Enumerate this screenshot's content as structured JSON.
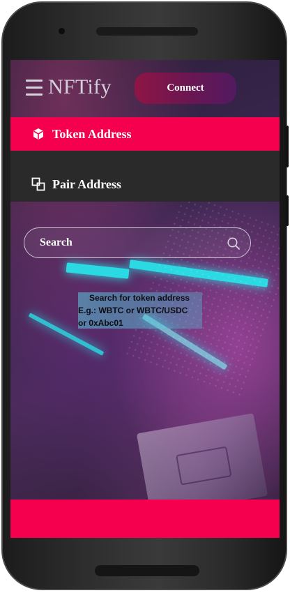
{
  "header": {
    "logo": "NFTify",
    "connect_label": "Connect"
  },
  "tabs": [
    {
      "label": "Token Address",
      "icon": "cube-icon",
      "active": true
    },
    {
      "label": "Pair Address",
      "icon": "pair-icon",
      "active": false
    }
  ],
  "search": {
    "placeholder": "Search",
    "value": ""
  },
  "hint": {
    "line1": "Search for token address",
    "line2": "E.g.: WBTC or WBTC/USDC",
    "line3": "or 0xAbc01"
  },
  "colors": {
    "accent": "#f5004e",
    "connect_start": "#8e1545",
    "connect_end": "#521a60",
    "tab_dark": "#2a2a2a",
    "highlight_cyan": "#29e3ea"
  }
}
